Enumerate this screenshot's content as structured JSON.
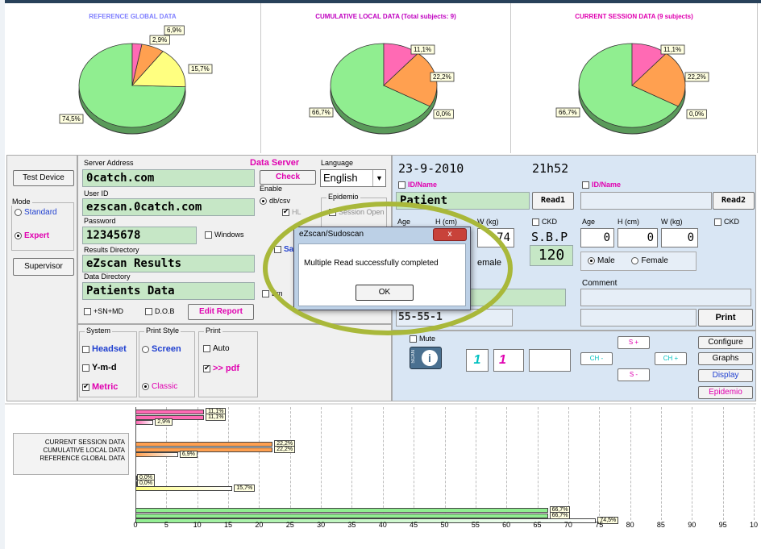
{
  "pies": [
    {
      "title": "REFERENCE GLOBAL DATA",
      "title_color": "#8080ff",
      "slices": [
        {
          "label": "74,5%",
          "value": 74.5,
          "color": "#90ee90"
        },
        {
          "label": "15,7%",
          "value": 15.7,
          "color": "#ffff80"
        },
        {
          "label": "6,9%",
          "value": 6.9,
          "color": "#ffa050"
        },
        {
          "label": "2,9%",
          "value": 2.9,
          "color": "#ff6ab4"
        }
      ]
    },
    {
      "title": "CUMULATIVE LOCAL DATA (Total subjects: 9)",
      "title_color": "#c000c0",
      "slices": [
        {
          "label": "66,7%",
          "value": 66.7,
          "color": "#90ee90"
        },
        {
          "label": "0,0%",
          "value": 0,
          "color": "#ffff80"
        },
        {
          "label": "22,2%",
          "value": 22.2,
          "color": "#ffa050"
        },
        {
          "label": "11,1%",
          "value": 11.1,
          "color": "#ff6ab4"
        }
      ]
    },
    {
      "title": "CURRENT SESSION DATA (9 subjects)",
      "title_color": "#e000b0",
      "slices": [
        {
          "label": "66,7%",
          "value": 66.7,
          "color": "#90ee90"
        },
        {
          "label": "0,0%",
          "value": 0,
          "color": "#ffff80"
        },
        {
          "label": "22,2%",
          "value": 22.2,
          "color": "#ffa050"
        },
        {
          "label": "11,1%",
          "value": 11.1,
          "color": "#ff6ab4"
        }
      ]
    }
  ],
  "left": {
    "test_device": "Test Device",
    "mode_title": "Mode",
    "standard": "Standard",
    "expert": "Expert",
    "supervisor": "Supervisor"
  },
  "server": {
    "server_address_label": "Server Address",
    "server_address": "0catch.com",
    "user_id_label": "User ID",
    "user_id": "ezscan.0catch.com",
    "password_label": "Password",
    "password": "12345678",
    "windows": "Windows",
    "results_dir_label": "Results Directory",
    "results_dir": "eZscan Results",
    "data_dir_label": "Data Directory",
    "data_dir": "Patients Data",
    "sn_md": "+SN+MD",
    "dob": "D.O.B",
    "edit_report": "Edit Report",
    "data_server": "Data Server",
    "check": "Check",
    "enable": "Enable",
    "db_csv": "db/csv",
    "hl": "HL",
    "language_label": "Language",
    "language": "English",
    "epidemio": "Epidemio",
    "session_open": "Session Open",
    "sav": "Sav",
    "em": "Em"
  },
  "system": {
    "system_title": "System",
    "headset": "Headset",
    "ymd": "Y-m-d",
    "metric": "Metric",
    "printstyle_title": "Print Style",
    "screen": "Screen",
    "classic": "Classic",
    "print_title": "Print",
    "auto": "Auto",
    "pdf": ">> pdf"
  },
  "patient": {
    "date": "23-9-2010",
    "time": "21h52",
    "id_name": "ID/Name",
    "patient_value": "Patient",
    "read1": "Read1",
    "read2": "Read2",
    "age": "Age",
    "height": "H (cm)",
    "weight": "W (kg)",
    "ckd": "CKD",
    "sbp": "S.B.P",
    "sbp_value": "120",
    "weight1": "74",
    "female1_partial": "emale",
    "age2": "0",
    "height2": "0",
    "weight2": "0",
    "male": "Male",
    "female": "Female",
    "comment": "Comment",
    "print": "Print",
    "partial_num": "55-55-1"
  },
  "controls": {
    "mute": "Mute",
    "scan": "SCAN",
    "one_a": "1",
    "one_b": "1",
    "ch_minus": "CH -",
    "ch_plus": "CH +",
    "s_plus": "S +",
    "s_minus": "S -",
    "configure": "Configure",
    "graphs": "Graphs",
    "display": "Display",
    "epidemio": "Epidemio"
  },
  "dialog": {
    "title": "eZscan/Sudoscan",
    "message": "Multiple Read successfully completed",
    "ok": "OK",
    "close": "x"
  },
  "barchart": {
    "legend": [
      "CURRENT SESSION DATA",
      "CUMULATIVE LOCAL DATA",
      "REFERENCE GLOBAL DATA"
    ],
    "xticks": [
      "0",
      "5",
      "10",
      "15",
      "20",
      "25",
      "30",
      "35",
      "40",
      "45",
      "50",
      "55",
      "60",
      "65",
      "70",
      "75",
      "80",
      "85",
      "90",
      "95",
      "10"
    ]
  },
  "chart_data": {
    "type": "bar",
    "categories": [
      "Pink",
      "Orange",
      "Yellow",
      "Green"
    ],
    "series": [
      {
        "name": "CURRENT SESSION DATA",
        "values": [
          11.1,
          22.2,
          0.0,
          66.7
        ]
      },
      {
        "name": "CUMULATIVE LOCAL DATA",
        "values": [
          11.1,
          22.2,
          0.0,
          66.7
        ]
      },
      {
        "name": "REFERENCE GLOBAL DATA",
        "values": [
          2.9,
          6.9,
          15.7,
          74.5
        ]
      }
    ],
    "value_labels": [
      [
        "11,1%",
        "22,2%",
        "0,0%",
        "66,7%"
      ],
      [
        "11,1%",
        "22,2%",
        "0,0%",
        "66,7%"
      ],
      [
        "2,9%",
        "6,9%",
        "15,7%",
        "74,5%"
      ]
    ],
    "colors": [
      "#ff6ab4",
      "#ffa050",
      "#ffff80",
      "#90ee90"
    ],
    "xlim": [
      0,
      100
    ]
  }
}
